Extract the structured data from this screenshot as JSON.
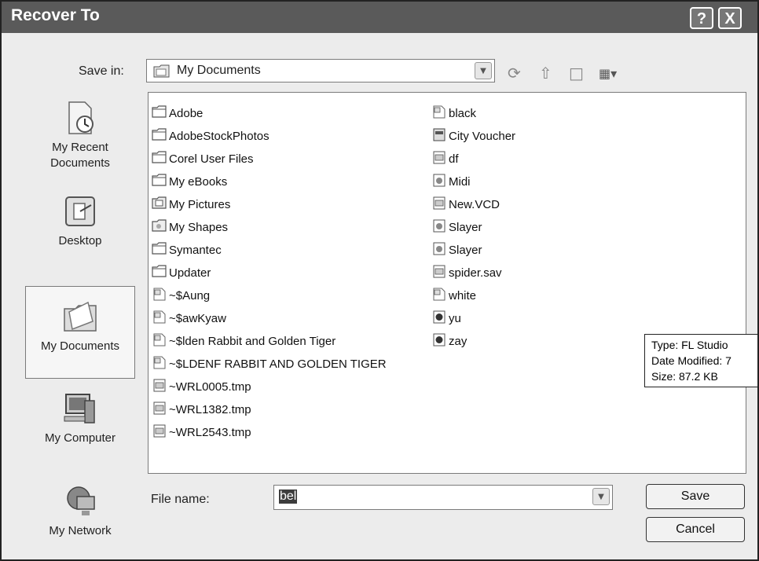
{
  "window": {
    "title": "Recover To",
    "help_label": "?",
    "close_label": "X"
  },
  "toolbar": {
    "save_in_label": "Save in:",
    "location": "My Documents",
    "tools": [
      "back-icon",
      "up-folder-icon",
      "new-folder-icon",
      "views-menu-icon"
    ]
  },
  "places": [
    {
      "label": "My Recent Documents",
      "icon": "recent-documents-icon",
      "selected": false
    },
    {
      "label": "Desktop",
      "icon": "desktop-icon",
      "selected": false
    },
    {
      "label": "My Documents",
      "icon": "my-documents-icon",
      "selected": true
    },
    {
      "label": "My Computer",
      "icon": "my-computer-icon",
      "selected": false
    },
    {
      "label": "My Network",
      "icon": "my-network-icon",
      "selected": false
    }
  ],
  "files": {
    "column1": [
      {
        "name": "Adobe",
        "icon": "folder"
      },
      {
        "name": "AdobeStockPhotos",
        "icon": "folder"
      },
      {
        "name": "Corel User Files",
        "icon": "folder"
      },
      {
        "name": "My eBooks",
        "icon": "folder"
      },
      {
        "name": "My Pictures",
        "icon": "pictures-folder"
      },
      {
        "name": "My Shapes",
        "icon": "shapes-folder"
      },
      {
        "name": "Symantec",
        "icon": "folder"
      },
      {
        "name": "Updater",
        "icon": "folder"
      },
      {
        "name": "~$Aung",
        "icon": "word-doc"
      },
      {
        "name": "~$awKyaw",
        "icon": "word-doc"
      },
      {
        "name": "~$lden Rabbit and Golden Tiger",
        "icon": "word-doc"
      },
      {
        "name": "~$LDENF RABBIT AND GOLDEN TIGER",
        "icon": "word-doc"
      },
      {
        "name": "~WRL0005.tmp",
        "icon": "tmp-file"
      },
      {
        "name": "~WRL1382.tmp",
        "icon": "tmp-file"
      },
      {
        "name": "~WRL2543.tmp",
        "icon": "tmp-file"
      }
    ],
    "column2": [
      {
        "name": "black",
        "icon": "word-doc"
      },
      {
        "name": "City Voucher",
        "icon": "shortcut"
      },
      {
        "name": "df",
        "icon": "tmp-file"
      },
      {
        "name": "Midi",
        "icon": "media-file"
      },
      {
        "name": "New.VCD",
        "icon": "tmp-file"
      },
      {
        "name": "Slayer",
        "icon": "media-file"
      },
      {
        "name": "Slayer",
        "icon": "media-file"
      },
      {
        "name": "spider.sav",
        "icon": "tmp-file"
      },
      {
        "name": "white",
        "icon": "word-doc"
      },
      {
        "name": "yu",
        "icon": "fl-studio-file"
      },
      {
        "name": "zay",
        "icon": "fl-studio-file"
      }
    ]
  },
  "tooltip": {
    "type_line": "Type: FL Studio",
    "date_line": "Date Modified: 7",
    "size_line": "Size: 87.2 KB"
  },
  "filename": {
    "label": "File name:",
    "value": "bel"
  },
  "buttons": {
    "save": "Save",
    "cancel": "Cancel"
  }
}
